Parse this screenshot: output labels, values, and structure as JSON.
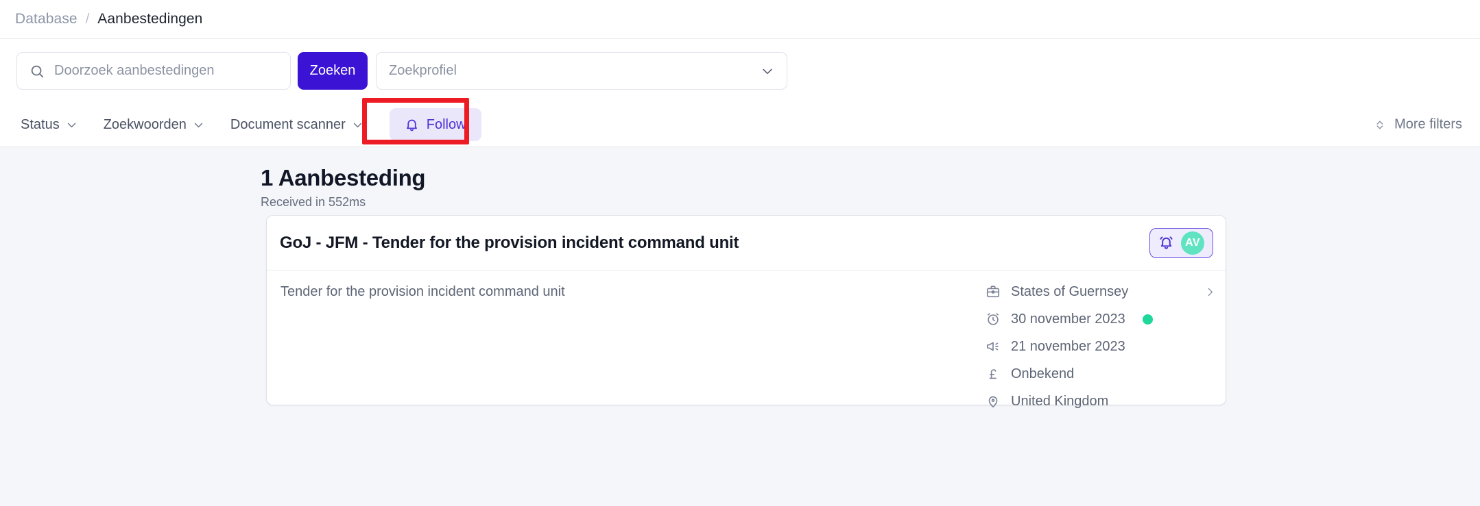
{
  "breadcrumb": {
    "root": "Database",
    "separator": "/",
    "current": "Aanbestedingen"
  },
  "search": {
    "placeholder": "Doorzoek aanbestedingen",
    "value": "",
    "icon": "search-icon",
    "button_label": "Zoeken",
    "profile_placeholder": "Zoekprofiel",
    "profile_value": "",
    "profile_chevron": "chevron-down-icon"
  },
  "filters": {
    "items": [
      {
        "label": "Status",
        "icon": "chevron-down-icon"
      },
      {
        "label": "Zoekwoorden",
        "icon": "chevron-down-icon"
      },
      {
        "label": "Document scanner",
        "icon": "chevron-down-icon"
      }
    ],
    "follow": {
      "label": "Follow",
      "icon": "bell-icon"
    },
    "more_filters": {
      "label": "More filters",
      "icon": "chevron-up-down-icon"
    },
    "highlight_color": "#ed1c24"
  },
  "results": {
    "count_label": "1 Aanbesteding",
    "timing_label": "Received in 552ms",
    "card": {
      "title": "GoJ - JFM - Tender for the provision incident command unit",
      "description": "Tender for the provision incident command unit",
      "actions": {
        "bell_icon": "bell-ring-icon",
        "avatar_initials": "AV",
        "avatar_color": "#5fe3c0"
      },
      "meta": [
        {
          "icon": "briefcase-icon",
          "text": "States of Guernsey",
          "chevron": "chevron-right-icon",
          "dot": false
        },
        {
          "icon": "alarm-clock-icon",
          "text": "30 november 2023",
          "dot": true,
          "dot_color": "#1ed79a"
        },
        {
          "icon": "megaphone-icon",
          "text": "21 november 2023",
          "dot": false
        },
        {
          "icon": "pound-sterling-icon",
          "text": "Onbekend",
          "dot": false
        },
        {
          "icon": "map-pin-icon",
          "text": "United Kingdom",
          "dot": false
        }
      ]
    }
  },
  "theme": {
    "accent": "#3a13d4",
    "follow_bg": "#eae7fb",
    "follow_fg": "#4f31d6",
    "page_bg": "#f5f6fa"
  }
}
